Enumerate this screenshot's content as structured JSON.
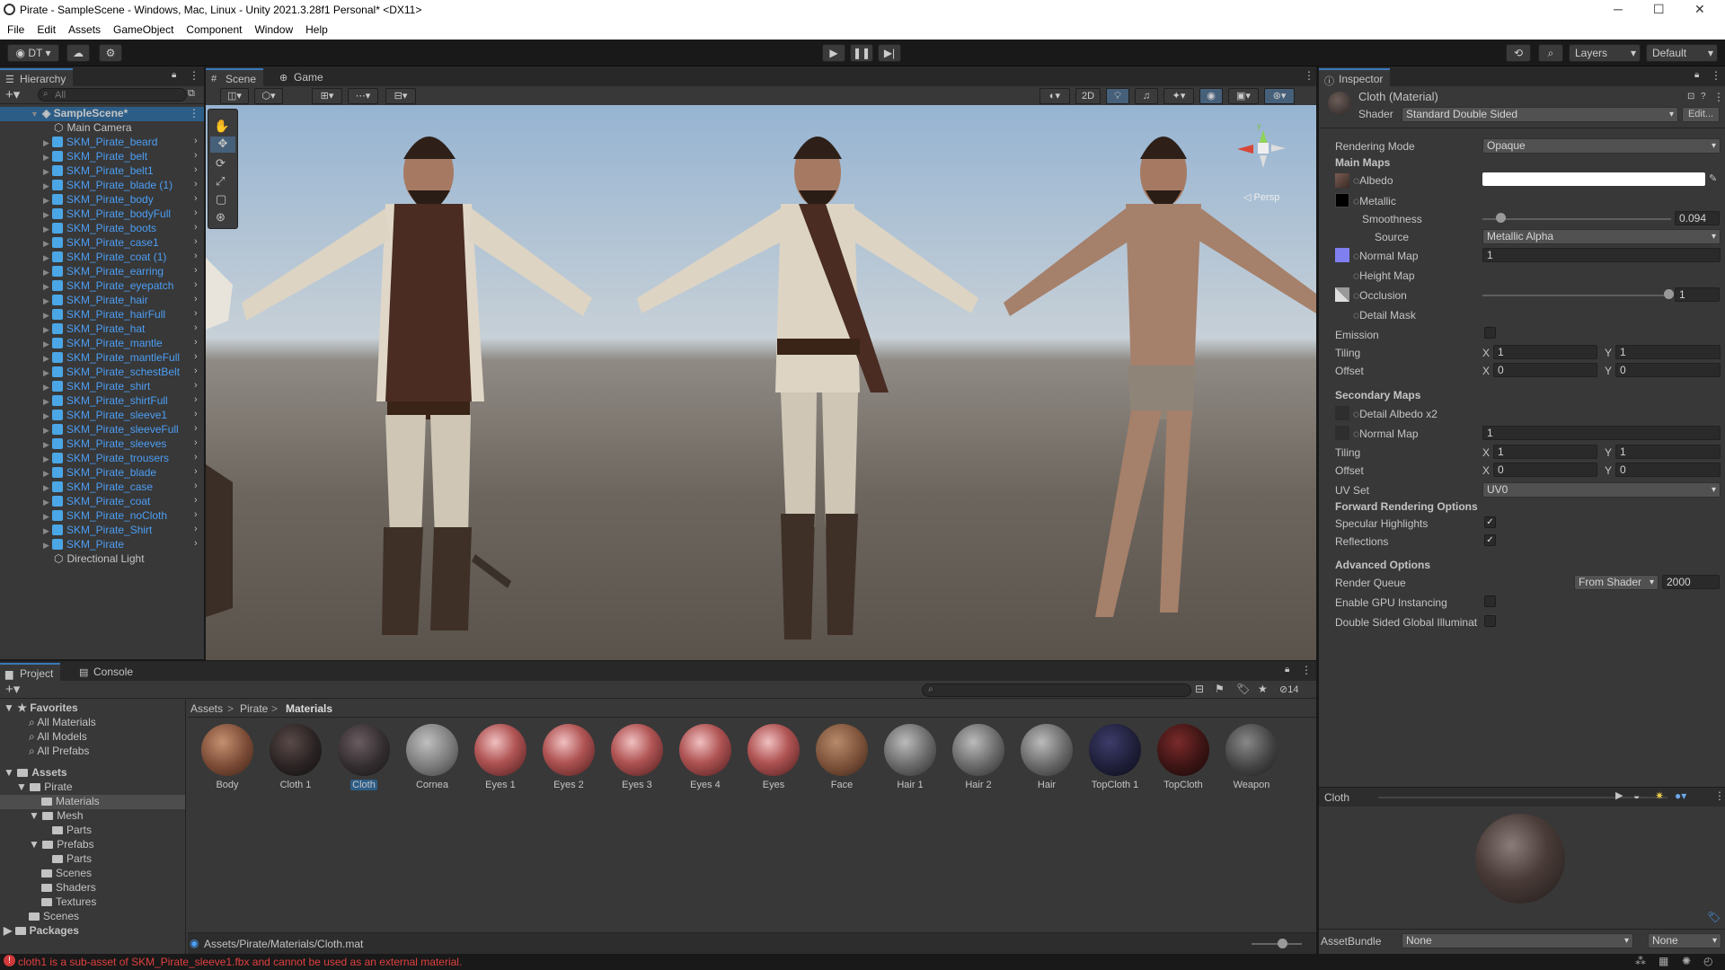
{
  "window": {
    "title": "Pirate - SampleScene - Windows, Mac, Linux - Unity 2021.3.28f1 Personal* <DX11>",
    "minimize": "─",
    "maximize": "☐",
    "close": "✕"
  },
  "menu": [
    "File",
    "Edit",
    "Assets",
    "GameObject",
    "Component",
    "Window",
    "Help"
  ],
  "toolbar": {
    "account": "DT",
    "layers": "Layers",
    "layout": "Default"
  },
  "hierarchy": {
    "tab": "Hierarchy",
    "search_placeholder": "All",
    "scene": "SampleScene*",
    "items": [
      "Main Camera",
      "SKM_Pirate_beard",
      "SKM_Pirate_belt",
      "SKM_Pirate_belt1",
      "SKM_Pirate_blade (1)",
      "SKM_Pirate_body",
      "SKM_Pirate_bodyFull",
      "SKM_Pirate_boots",
      "SKM_Pirate_case1",
      "SKM_Pirate_coat (1)",
      "SKM_Pirate_earring",
      "SKM_Pirate_eyepatch",
      "SKM_Pirate_hair",
      "SKM_Pirate_hairFull",
      "SKM_Pirate_hat",
      "SKM_Pirate_mantle",
      "SKM_Pirate_mantleFull",
      "SKM_Pirate_schestBelt",
      "SKM_Pirate_shirt",
      "SKM_Pirate_shirtFull",
      "SKM_Pirate_sleeve1",
      "SKM_Pirate_sleeveFull",
      "SKM_Pirate_sleeves",
      "SKM_Pirate_trousers",
      "SKM_Pirate_blade",
      "SKM_Pirate_case",
      "SKM_Pirate_coat",
      "SKM_Pirate_noCloth",
      "SKM_Pirate_Shirt",
      "SKM_Pirate",
      "Directional Light"
    ]
  },
  "scene": {
    "tab_scene": "Scene",
    "tab_game": "Game",
    "mode_2d": "2D",
    "persp": "Persp",
    "gizmo_y": "y"
  },
  "inspector": {
    "tab": "Inspector",
    "name": "Cloth (Material)",
    "shader_label": "Shader",
    "shader": "Standard Double Sided",
    "edit": "Edit...",
    "rendering_mode_label": "Rendering Mode",
    "rendering_mode": "Opaque",
    "main_maps": "Main Maps",
    "albedo": "Albedo",
    "metallic": "Metallic",
    "smoothness": "Smoothness",
    "smoothness_val": "0.094",
    "smoothness_fraction": 0.094,
    "source_label": "Source",
    "source": "Metallic Alpha",
    "normal_map": "Normal Map",
    "normal_val": "1",
    "height_map": "Height Map",
    "occlusion": "Occlusion",
    "occlusion_val": "1",
    "detail_mask": "Detail Mask",
    "emission": "Emission",
    "tiling": "Tiling",
    "offset": "Offset",
    "x": "X",
    "y": "Y",
    "tx": "1",
    "ty": "1",
    "ox": "0",
    "oy": "0",
    "secondary": "Secondary Maps",
    "detail_albedo": "Detail Albedo x2",
    "normal_map2": "Normal Map",
    "normal2_val": "1",
    "tiling2": "Tiling",
    "offset2": "Offset",
    "t2x": "1",
    "t2y": "1",
    "o2x": "0",
    "o2y": "0",
    "uv_set": "UV Set",
    "uv_val": "UV0",
    "forward": "Forward Rendering Options",
    "specular": "Specular Highlights",
    "reflections": "Reflections",
    "check": "✓",
    "advanced": "Advanced Options",
    "render_queue": "Render Queue",
    "rq_dd": "From Shader",
    "rq_val": "2000",
    "gpu": "Enable GPU Instancing",
    "dsgi": "Double Sided Global Illuminat",
    "preview_title": "Cloth",
    "assetbundle": "AssetBundle",
    "ab1": "None",
    "ab2": "None"
  },
  "project": {
    "tab_project": "Project",
    "tab_console": "Console",
    "count": "14",
    "favorites": "Favorites",
    "fav_items": [
      "All Materials",
      "All Models",
      "All Prefabs"
    ],
    "assets": "Assets",
    "tree": [
      "Pirate",
      "Materials",
      "Mesh",
      "Parts",
      "Prefabs",
      "Parts",
      "Scenes",
      "Shaders",
      "Textures"
    ],
    "scenes": "Scenes",
    "packages": "Packages",
    "breadcrumb": [
      "Assets",
      "Pirate",
      "Materials"
    ],
    "sep": ">",
    "materials": [
      "Body",
      "Cloth 1",
      "Cloth",
      "Cornea",
      "Eyes 1",
      "Eyes 2",
      "Eyes 3",
      "Eyes 4",
      "Eyes",
      "Face",
      "Hair 1",
      "Hair 2",
      "Hair",
      "TopCloth 1",
      "TopCloth",
      "Weapon"
    ],
    "path": "Assets/Pirate/Materials/Cloth.mat"
  },
  "status": {
    "error": "cloth1 is a sub-asset of SKM_Pirate_sleeve1.fbx and cannot be used as an external material."
  },
  "colors": {
    "accent": "#3a79bb",
    "link": "#4c9ef4",
    "error": "#e04040"
  }
}
